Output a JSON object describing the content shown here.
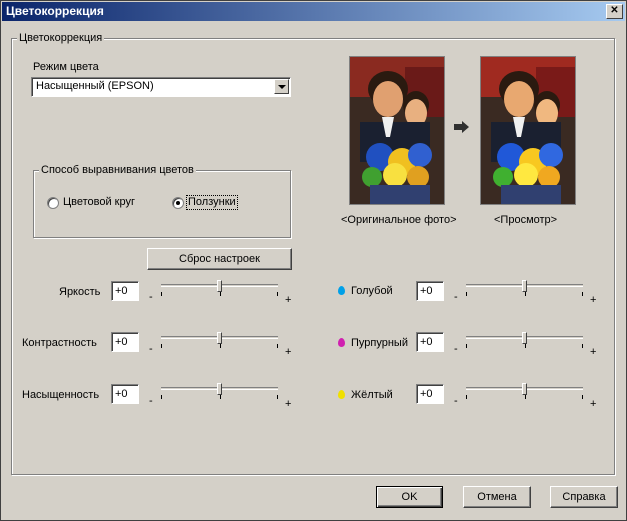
{
  "window": {
    "title": "Цветокоррекция",
    "close_glyph": "✕"
  },
  "group_main": {
    "label": "Цветокоррекция"
  },
  "color_mode": {
    "label": "Режим цвета",
    "value": "Насыщенный (EPSON)"
  },
  "alignment": {
    "label": "Способ выравнивания цветов",
    "options": [
      {
        "label": "Цветовой круг",
        "selected": false
      },
      {
        "label": "Ползунки",
        "selected": true
      }
    ]
  },
  "preview": {
    "original_caption": "<Оригинальное фото>",
    "preview_caption": "<Просмотр>"
  },
  "reset_button": "Сброс настроек",
  "sliders_left": [
    {
      "label": "Яркость",
      "value": "+0",
      "level": 0
    },
    {
      "label": "Контрастность",
      "value": "+0",
      "level": 0
    },
    {
      "label": "Насыщенность",
      "value": "+0",
      "level": 0
    }
  ],
  "sliders_right": [
    {
      "label": "Голубой",
      "value": "+0",
      "level": 0,
      "color": "#00a0e8",
      "icon": "cyan-drop-icon"
    },
    {
      "label": "Пурпурный",
      "value": "+0",
      "level": 0,
      "color": "#d020b0",
      "icon": "magenta-drop-icon"
    },
    {
      "label": "Жёлтый",
      "value": "+0",
      "level": 0,
      "color": "#f0e000",
      "icon": "yellow-drop-icon"
    }
  ],
  "range_minus": "-",
  "range_plus": "+",
  "buttons": {
    "ok": "OK",
    "cancel": "Отмена",
    "help": "Справка"
  }
}
